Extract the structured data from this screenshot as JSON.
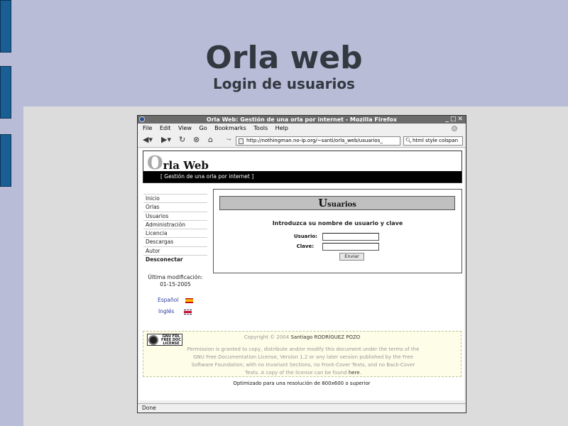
{
  "slide": {
    "title": "Orla web",
    "subtitle": "Login de usuarios"
  },
  "browser": {
    "title": "Orla Web: Gestión de una orla por internet - Mozilla Firefox",
    "window_controls": "_□✕",
    "menu": [
      "File",
      "Edit",
      "View",
      "Go",
      "Bookmarks",
      "Tools",
      "Help"
    ],
    "url": "http://nothingman.no-ip.org/~santi/orla_web/usuarios_",
    "search": "html style colspan",
    "status": "Done"
  },
  "site": {
    "logo_initial": "O",
    "logo_rest": "rla Web",
    "tagline": "[ Gestión de una orla por internet ]",
    "nav": [
      {
        "label": "Inicio"
      },
      {
        "label": "Orlas"
      },
      {
        "label": "Usuarios"
      },
      {
        "label": "Administración"
      },
      {
        "label": "Licencia"
      },
      {
        "label": "Descargas"
      },
      {
        "label": "Autor"
      },
      {
        "label": "Desconectar"
      }
    ],
    "last_modified_label": "Última modificación:",
    "last_modified_date": "01-15-2005",
    "languages": [
      {
        "label": "Español",
        "flag": "spain-flag-icon"
      },
      {
        "label": "Inglés",
        "flag": "uk-flag-icon"
      }
    ]
  },
  "login": {
    "header_initial": "U",
    "header_rest": "suarios",
    "prompt": "Introduzca su nombre de usuario y clave",
    "user_label": "Usuario:",
    "password_label": "Clave:",
    "user_value": "",
    "password_value": "",
    "submit": "Enviar"
  },
  "footer": {
    "gnu_logo": "GNU FDL FREE DOC LICENSE",
    "copyright_prefix": "Copyright © 2004",
    "author": "Santiago RODRÍGUEZ POZO",
    "license": "Permission is granted to copy, distribute and/or modify this document under the terms of the GNU Free Documentation License, Version 1.2 or any later version published by the Free Software Foundation; with no Invariant Sections, no Front-Cover Texts, and no Back-Cover Texts. A copy of the license can be found",
    "here": "here",
    "optimized": "Optimizado para una resolución de 800x600 o superior"
  },
  "colors": {
    "slide_bg": "#b8bcd7",
    "side_tab": "#1a5f93",
    "content_bg": "#dcdcdc",
    "link": "#2a3aa0"
  }
}
